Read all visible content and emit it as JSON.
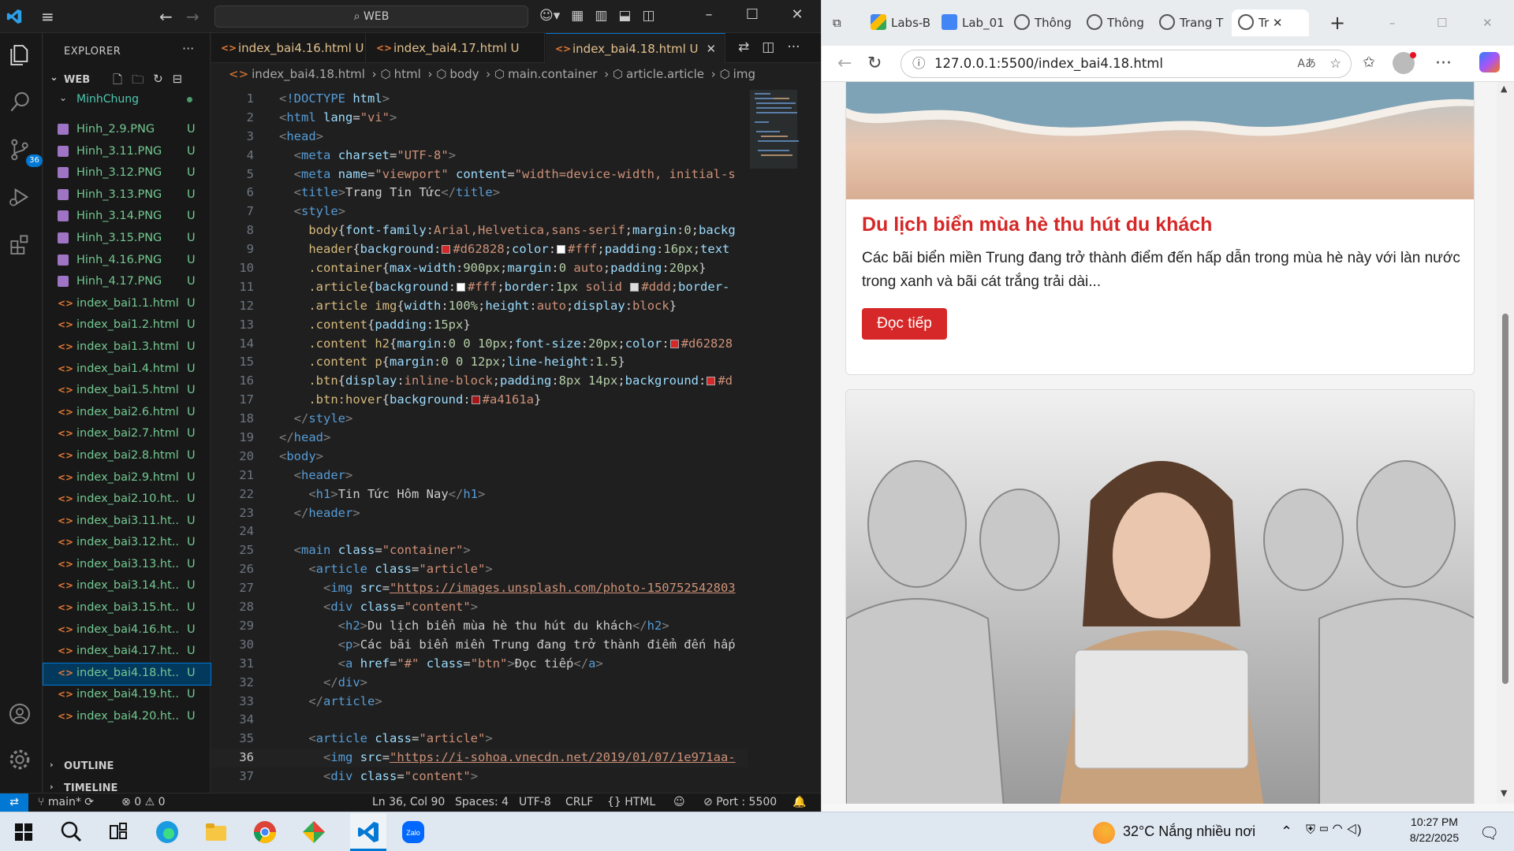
{
  "vscode": {
    "search": "WEB",
    "explorer_title": "EXPLORER",
    "workspace": "WEB",
    "folder": "MinhChung",
    "files": [
      {
        "name": "Hinh_2.9.PNG",
        "status": "U",
        "kind": "png"
      },
      {
        "name": "Hinh_3.11.PNG",
        "status": "U",
        "kind": "png"
      },
      {
        "name": "Hinh_3.12.PNG",
        "status": "U",
        "kind": "png"
      },
      {
        "name": "Hinh_3.13.PNG",
        "status": "U",
        "kind": "png"
      },
      {
        "name": "Hinh_3.14.PNG",
        "status": "U",
        "kind": "png"
      },
      {
        "name": "Hinh_3.15.PNG",
        "status": "U",
        "kind": "png"
      },
      {
        "name": "Hinh_4.16.PNG",
        "status": "U",
        "kind": "png"
      },
      {
        "name": "Hinh_4.17.PNG",
        "status": "U",
        "kind": "png"
      },
      {
        "name": "index_bai1.1.html",
        "status": "U",
        "kind": "html"
      },
      {
        "name": "index_bai1.2.html",
        "status": "U",
        "kind": "html"
      },
      {
        "name": "index_bai1.3.html",
        "status": "U",
        "kind": "html"
      },
      {
        "name": "index_bai1.4.html",
        "status": "U",
        "kind": "html"
      },
      {
        "name": "index_bai1.5.html",
        "status": "U",
        "kind": "html"
      },
      {
        "name": "index_bai2.6.html",
        "status": "U",
        "kind": "html"
      },
      {
        "name": "index_bai2.7.html",
        "status": "U",
        "kind": "html"
      },
      {
        "name": "index_bai2.8.html",
        "status": "U",
        "kind": "html"
      },
      {
        "name": "index_bai2.9.html",
        "status": "U",
        "kind": "html"
      },
      {
        "name": "index_bai2.10.ht...",
        "status": "U",
        "kind": "html"
      },
      {
        "name": "index_bai3.11.ht...",
        "status": "U",
        "kind": "html"
      },
      {
        "name": "index_bai3.12.ht...",
        "status": "U",
        "kind": "html"
      },
      {
        "name": "index_bai3.13.ht...",
        "status": "U",
        "kind": "html"
      },
      {
        "name": "index_bai3.14.ht...",
        "status": "U",
        "kind": "html"
      },
      {
        "name": "index_bai3.15.ht...",
        "status": "U",
        "kind": "html"
      },
      {
        "name": "index_bai4.16.ht...",
        "status": "U",
        "kind": "html"
      },
      {
        "name": "index_bai4.17.ht...",
        "status": "U",
        "kind": "html"
      },
      {
        "name": "index_bai4.18.ht...",
        "status": "U",
        "kind": "html",
        "selected": true
      },
      {
        "name": "index_bai4.19.ht...",
        "status": "U",
        "kind": "html"
      },
      {
        "name": "index_bai4.20.ht...",
        "status": "U",
        "kind": "html"
      }
    ],
    "outline": "OUTLINE",
    "timeline": "TIMELINE",
    "source_control_badge": "36",
    "tabs": [
      {
        "label": "index_bai4.16.html",
        "status": "U"
      },
      {
        "label": "index_bai4.17.html",
        "status": "U"
      },
      {
        "label": "index_bai4.18.html",
        "status": "U",
        "active": true
      }
    ],
    "breadcrumbs": [
      "index_bai4.18.html",
      "html",
      "body",
      "main.container",
      "article.article",
      "img"
    ],
    "current_line": "36",
    "status": {
      "branch": "main*",
      "problems": "0",
      "warnings": "0",
      "position": "Ln 36, Col 90",
      "spaces": "Spaces: 4",
      "encoding": "UTF-8",
      "eol": "CRLF",
      "language": "HTML",
      "port": "Port : 5500"
    }
  },
  "edge": {
    "tabs": [
      {
        "label": "Labs-B"
      },
      {
        "label": "Lab_01"
      },
      {
        "label": "Thông"
      },
      {
        "label": "Thông"
      },
      {
        "label": "Trang T"
      },
      {
        "label": "Tr",
        "active": true
      }
    ],
    "url": "127.0.0.1:5500/index_bai4.18.html",
    "article1": {
      "title": "Du lịch biển mùa hè thu hút du khách",
      "text": "Các bãi biển miền Trung đang trở thành điểm đến hấp dẫn trong mùa hè này với làn nước trong xanh và bãi cát trắng trải dài...",
      "button": "Đọc tiếp"
    }
  },
  "taskbar": {
    "weather_temp": "32°C",
    "weather_text": "Nắng nhiều nơi",
    "time": "10:27 PM",
    "date": "8/22/2025"
  },
  "colors": {
    "accent": "#0078d4",
    "brand_red": "#d62828",
    "hover_red": "#a4161a"
  }
}
